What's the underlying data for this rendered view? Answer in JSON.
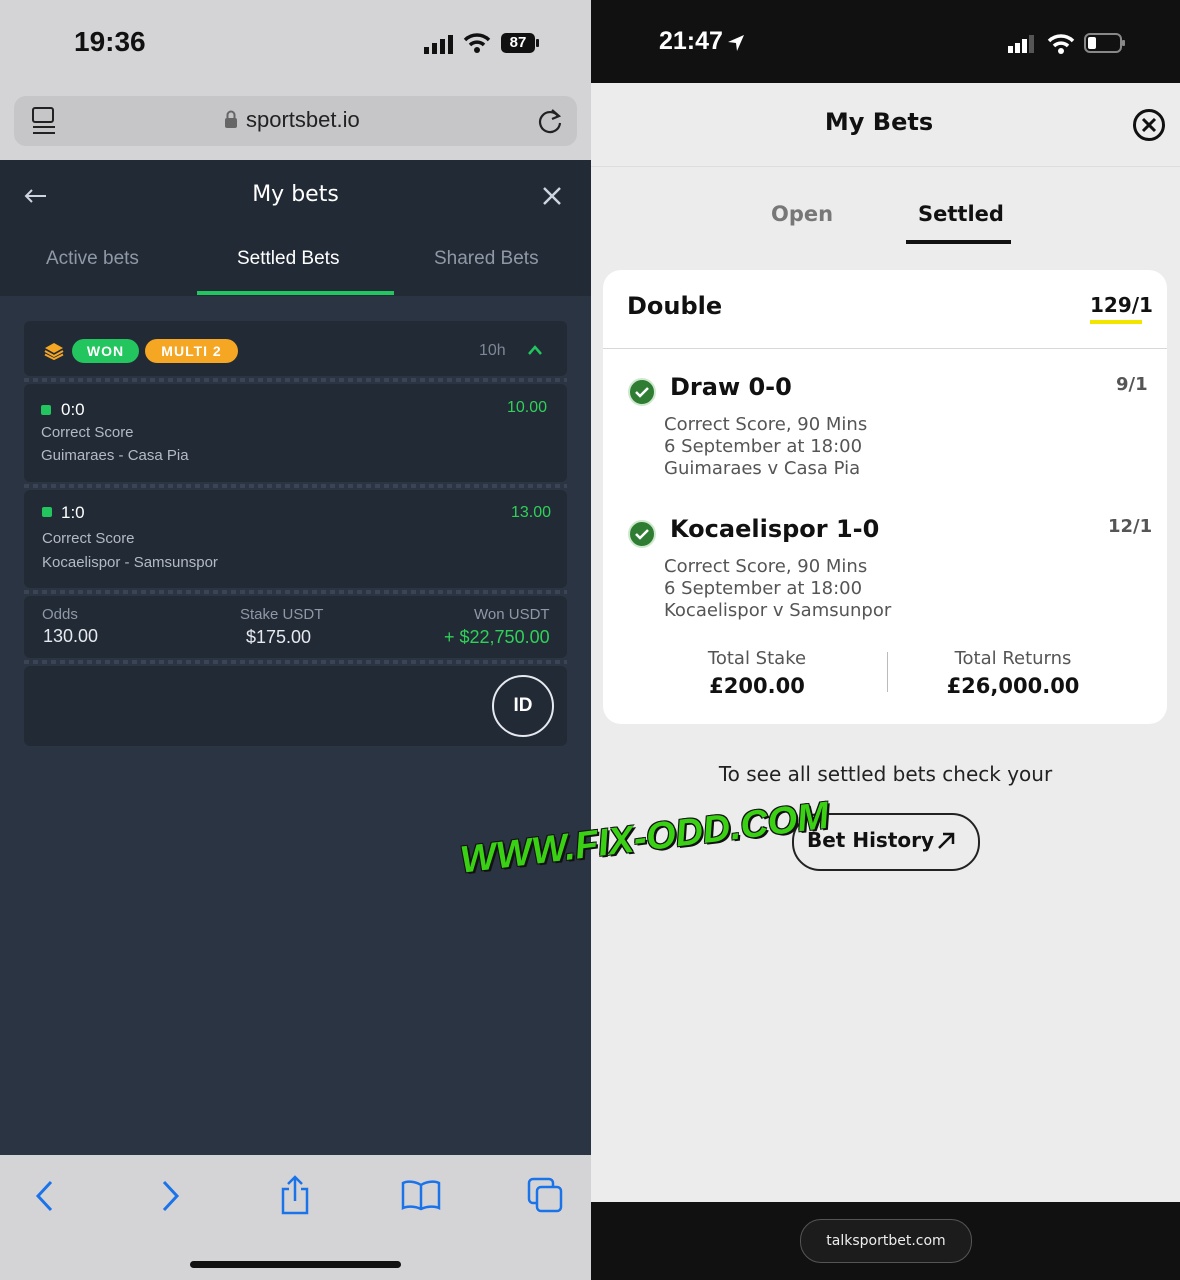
{
  "left": {
    "status": {
      "time": "19:36",
      "battery": "87"
    },
    "browser": {
      "url": "sportsbet.io"
    },
    "header": {
      "title": "My bets"
    },
    "tabs": [
      {
        "label": "Active bets"
      },
      {
        "label": "Settled Bets"
      },
      {
        "label": "Shared Bets"
      }
    ],
    "bet": {
      "badges": {
        "won": "WON",
        "multi": "MULTI 2"
      },
      "time_ago": "10h",
      "selections": [
        {
          "score": "0:0",
          "odds": "10.00",
          "market": "Correct Score",
          "match": "Guimaraes - Casa Pia"
        },
        {
          "score": "1:0",
          "odds": "13.00",
          "market": "Correct Score",
          "match": "Kocaelispor - Samsunspor"
        }
      ],
      "summary": {
        "odds_label": "Odds",
        "odds_value": "130.00",
        "stake_label": "Stake USDT",
        "stake_value": "$175.00",
        "won_label": "Won USDT",
        "won_value": "+ $22,750.00"
      },
      "id_button": "ID"
    }
  },
  "right": {
    "status": {
      "time": "21:47"
    },
    "header": {
      "title": "My Bets"
    },
    "tabs": [
      {
        "label": "Open"
      },
      {
        "label": "Settled"
      }
    ],
    "bet": {
      "type": "Double",
      "total_odds": "129/1",
      "selections": [
        {
          "title": "Draw 0-0",
          "odds": "9/1",
          "market": "Correct Score, 90 Mins",
          "date": "6 September at 18:00",
          "match": "Guimaraes v Casa Pia"
        },
        {
          "title": "Kocaelispor 1-0",
          "odds": "12/1",
          "market": "Correct Score, 90 Mins",
          "date": "6 September at 18:00",
          "match": "Kocaelispor v Samsunpor"
        }
      ],
      "stake_label": "Total Stake",
      "stake_value": "£200.00",
      "returns_label": "Total Returns",
      "returns_value": "£26,000.00"
    },
    "notice": "To see all settled bets check your",
    "history_button": "Bet History",
    "site": "talksportbet.com"
  },
  "watermark": "WWW.FIX-ODD.COM",
  "colors": {
    "green": "#23c55e",
    "orange": "#f5a623",
    "right_check": "#2e7d32",
    "won_text": "#2fd158"
  }
}
